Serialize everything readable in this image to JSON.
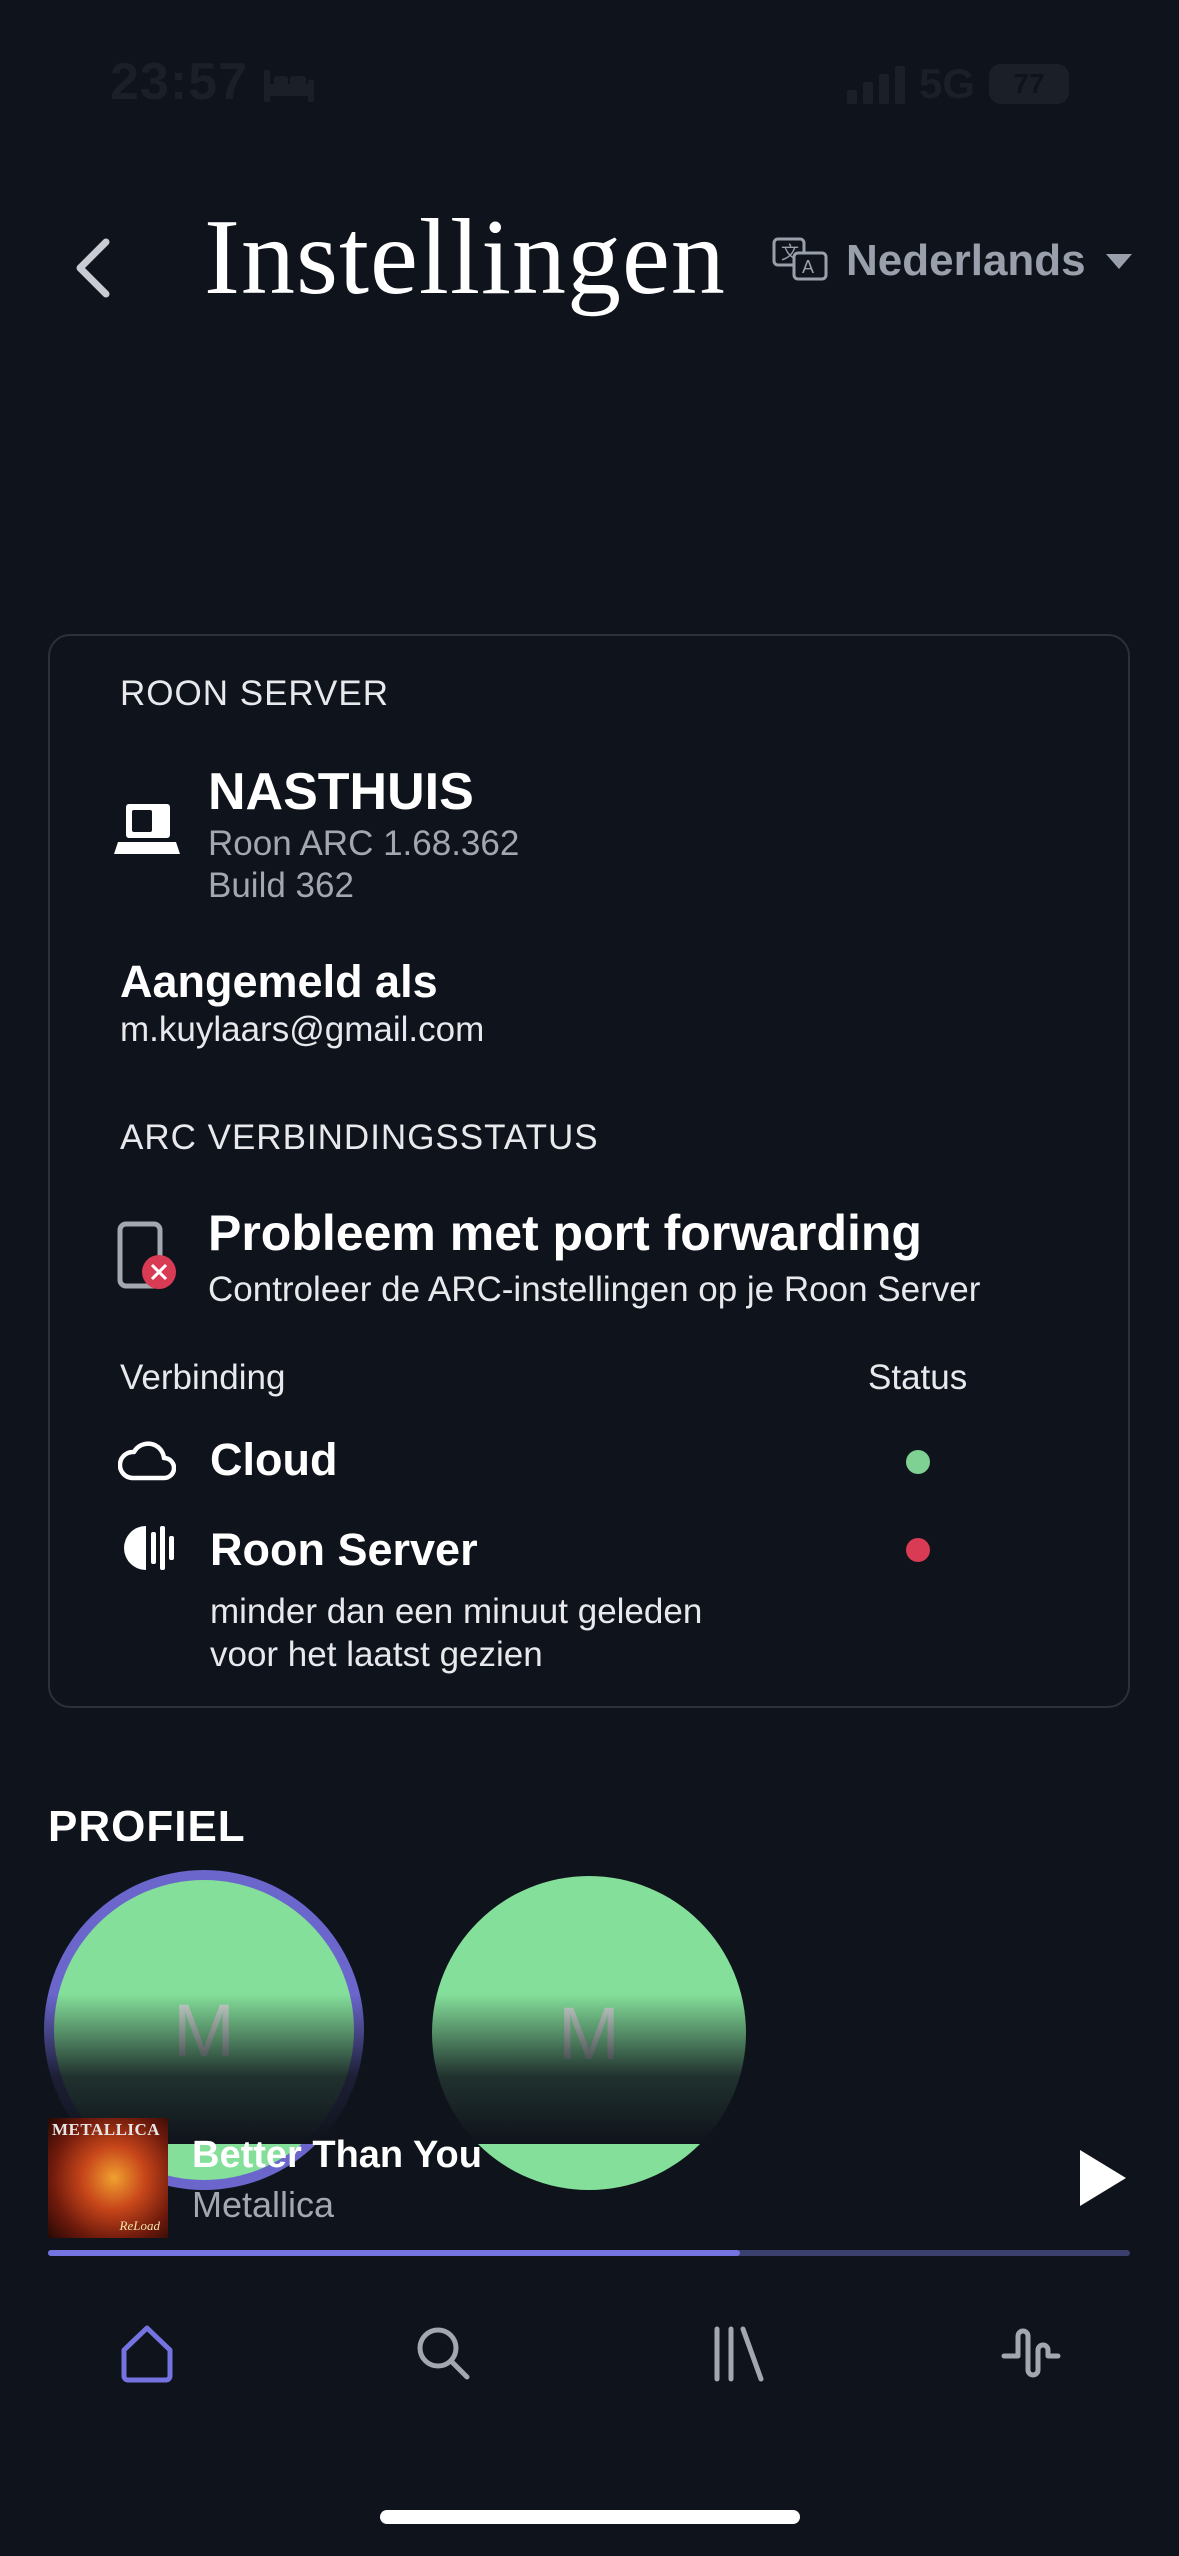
{
  "status_bar": {
    "time": "23:57",
    "network": "5G",
    "battery": "77"
  },
  "header": {
    "title": "Instellingen",
    "language": "Nederlands"
  },
  "server_card": {
    "section_label": "ROON SERVER",
    "server_name": "NASTHUIS",
    "version": "Roon ARC 1.68.362",
    "build": "Build 362",
    "signed_in_label": "Aangemeld als",
    "email": "m.kuylaars@gmail.com",
    "arc_status_label": "ARC VERBINDINGSSTATUS",
    "problem_title": "Probleem met port forwarding",
    "problem_sub": "Controleer de ARC-instellingen op je Roon Server",
    "col_connection": "Verbinding",
    "col_status": "Status",
    "connections": [
      {
        "name": "Cloud",
        "status_color": "#7ed193"
      },
      {
        "name": "Roon Server",
        "status_color": "#d93b55",
        "note_line1": "minder dan een minuut geleden",
        "note_line2": "voor het laatst gezien"
      }
    ]
  },
  "profile": {
    "label": "PROFIEL",
    "avatars": [
      {
        "initial": "M",
        "selected": true
      },
      {
        "initial": "M",
        "selected": false
      }
    ]
  },
  "now_playing": {
    "title": "Better Than You",
    "artist": "Metallica",
    "album_cover_text": "METALLICA",
    "album_cover_subtext": "ReLoad",
    "progress_percent": 64
  },
  "nav": {
    "items": [
      "home-icon",
      "search-icon",
      "library-icon",
      "waveform-icon"
    ],
    "active_color": "#7473e0"
  },
  "colors": {
    "background": "#0f131b",
    "accent": "#7473e0",
    "avatar": "#84df9a",
    "error": "#d93b55",
    "ok": "#7ed193"
  }
}
